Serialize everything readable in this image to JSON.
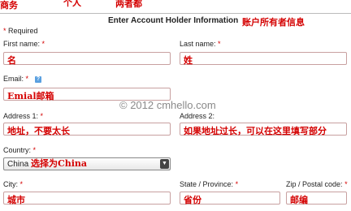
{
  "top_annotations": {
    "business": "商务",
    "personal": "个人",
    "both": "两者都"
  },
  "header": {
    "title": "Enter Account Holder Information",
    "annotation": "账户所有者信息"
  },
  "required_note": "Required",
  "required_star": "*",
  "fields": {
    "first_name": {
      "label": "First name:",
      "value": "名"
    },
    "last_name": {
      "label": "Last name:",
      "value": "姓"
    },
    "email": {
      "label": "Email:",
      "value": "Emial邮箱"
    },
    "address1": {
      "label": "Address 1:",
      "value": "地址，不要太长"
    },
    "address2": {
      "label": "Address 2:",
      "value": "如果地址过长，可以在这里填写部分"
    },
    "country": {
      "label": "Country:",
      "value": "China",
      "annotation": "选择为China"
    },
    "city": {
      "label": "City:",
      "value": "城市"
    },
    "state": {
      "label": "State / Province:",
      "value": "省份"
    },
    "zip": {
      "label": "Zip / Postal code:",
      "value": "邮编"
    }
  },
  "watermark": "© 2012 cmhello.com",
  "colors": {
    "annotation": "#d40000",
    "field_border": "#c8a0a0"
  },
  "icons": {
    "help": "help-icon",
    "dropdown": "chevron-down-icon"
  }
}
